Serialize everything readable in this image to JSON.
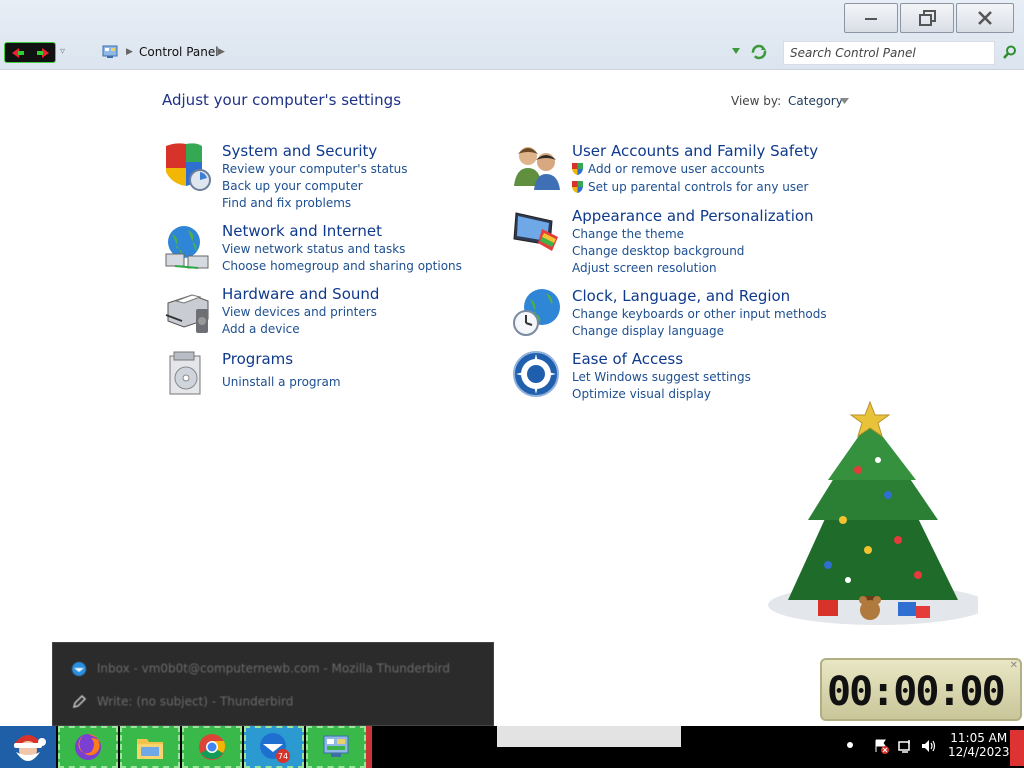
{
  "window": {
    "address": {
      "location": "Control Panel"
    },
    "search": {
      "placeholder": "Search Control Panel"
    },
    "controls": {
      "minimize": "minimize",
      "restore": "restore",
      "close": "close"
    }
  },
  "content": {
    "heading": "Adjust your computer's settings",
    "view_by_label": "View by:",
    "view_by_value": "Category",
    "categories": [
      {
        "icon": "shield-security-icon",
        "title": "System and Security",
        "links": [
          "Review your computer's status",
          "Back up your computer",
          "Find and fix problems"
        ]
      },
      {
        "icon": "network-globe-icon",
        "title": "Network and Internet",
        "links": [
          "View network status and tasks",
          "Choose homegroup and sharing options"
        ]
      },
      {
        "icon": "printer-hardware-icon",
        "title": "Hardware and Sound",
        "links": [
          "View devices and printers",
          "Add a device"
        ]
      },
      {
        "icon": "programs-box-icon",
        "title": "Programs",
        "links": [
          "Uninstall a program"
        ]
      },
      {
        "icon": "users-icon",
        "title": "User Accounts and Family Safety",
        "links": [
          "Add or remove user accounts",
          "Set up parental controls for any user"
        ]
      },
      {
        "icon": "appearance-monitor-icon",
        "title": "Appearance and Personalization",
        "links": [
          "Change the theme",
          "Change desktop background",
          "Adjust screen resolution"
        ]
      },
      {
        "icon": "clock-globe-icon",
        "title": "Clock, Language, and Region",
        "links": [
          "Change keyboards or other input methods",
          "Change display language"
        ]
      },
      {
        "icon": "ease-of-access-icon",
        "title": "Ease of Access",
        "links": [
          "Let Windows suggest settings",
          "Optimize visual display"
        ]
      }
    ]
  },
  "desktop": {
    "clock_widget": {
      "display": "00:00:00"
    }
  },
  "thumbnail_popup": {
    "items": [
      {
        "icon": "thunderbird-icon",
        "label": "Inbox - vm0b0t@computernewb.com - Mozilla Thunderbird"
      },
      {
        "icon": "pencil-icon",
        "label": "Write: (no subject) - Thunderbird"
      }
    ]
  },
  "taskbar": {
    "apps": [
      {
        "name": "firefox-icon"
      },
      {
        "name": "file-explorer-icon"
      },
      {
        "name": "chrome-icon"
      },
      {
        "name": "thunderbird-icon",
        "badge": "74"
      },
      {
        "name": "control-panel-icon"
      }
    ],
    "tray": {
      "time": "11:05 AM",
      "date": "12/4/2023"
    }
  },
  "colors": {
    "link": "#1d4f91",
    "title": "#0f3a8c",
    "taskbar_app": "#39b94a"
  }
}
